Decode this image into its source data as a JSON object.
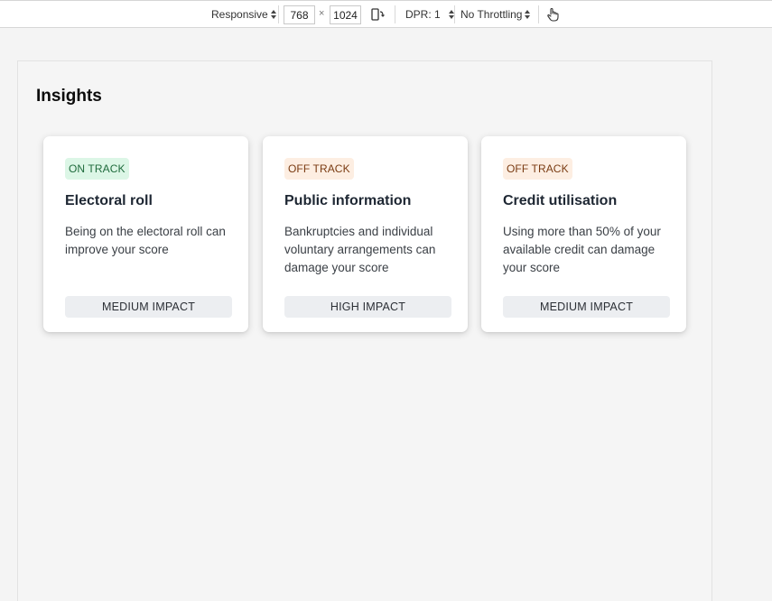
{
  "toolbar": {
    "device": "Responsive",
    "width": "768",
    "times": "×",
    "height": "1024",
    "dpr": "DPR: 1",
    "throttling": "No Throttling",
    "icons": [
      "rotate-device-icon",
      "touch-simulation-icon"
    ]
  },
  "page": {
    "title": "Insights"
  },
  "cards": [
    {
      "status": "ON TRACK",
      "status_kind": "on",
      "title": "Electoral roll",
      "description": "Being on the electoral roll can improve your score",
      "impact": "MEDIUM IMPACT"
    },
    {
      "status": "OFF TRACK",
      "status_kind": "off",
      "title": "Public information",
      "description": "Bankruptcies and individual voluntary arrangements can damage your score",
      "impact": "HIGH IMPACT"
    },
    {
      "status": "OFF TRACK",
      "status_kind": "off",
      "title": "Credit utilisation",
      "description": "Using more than 50% of your available credit can damage your score",
      "impact": "MEDIUM IMPACT"
    }
  ],
  "colors": {
    "on_track_bg": "#dcf6e6",
    "off_track_bg": "#fdeee2",
    "impact_bg": "#eceef1"
  }
}
